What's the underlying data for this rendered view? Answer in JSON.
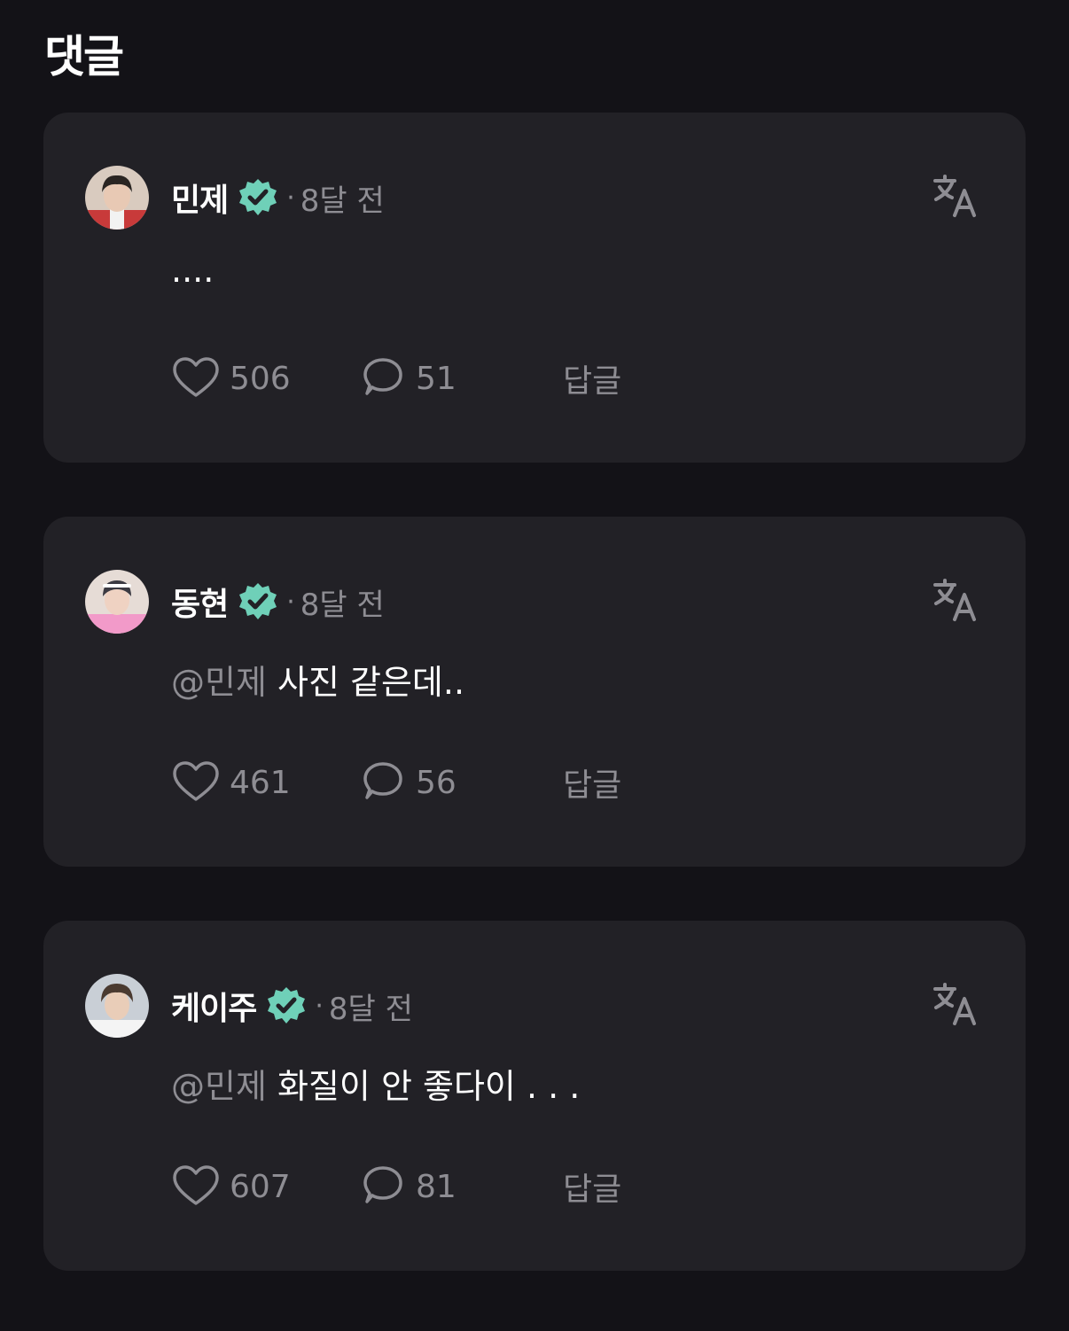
{
  "page": {
    "title": "댓글"
  },
  "colors": {
    "background": "#131217",
    "card": "#222126",
    "muted_text": "#8e8d93",
    "verified_badge": "#6fd0b8",
    "icon": "#8e8d93"
  },
  "icons": {
    "verified": "verified-badge-icon",
    "translate": "translate-icon",
    "like": "heart-icon",
    "comment": "speech-bubble-icon"
  },
  "comments": [
    {
      "username": "민제",
      "separator": "·",
      "time": "8달 전",
      "mention": "",
      "text": "....",
      "likes": "506",
      "replies": "51",
      "reply_label": "답글"
    },
    {
      "username": "동현",
      "separator": "·",
      "time": "8달 전",
      "mention": "@민제",
      "text": " 사진 같은데..",
      "likes": "461",
      "replies": "56",
      "reply_label": "답글"
    },
    {
      "username": "케이주",
      "separator": "·",
      "time": "8달 전",
      "mention": "@민제",
      "text": " 화질이 안 좋다이 . . .",
      "likes": "607",
      "replies": "81",
      "reply_label": "답글"
    }
  ]
}
